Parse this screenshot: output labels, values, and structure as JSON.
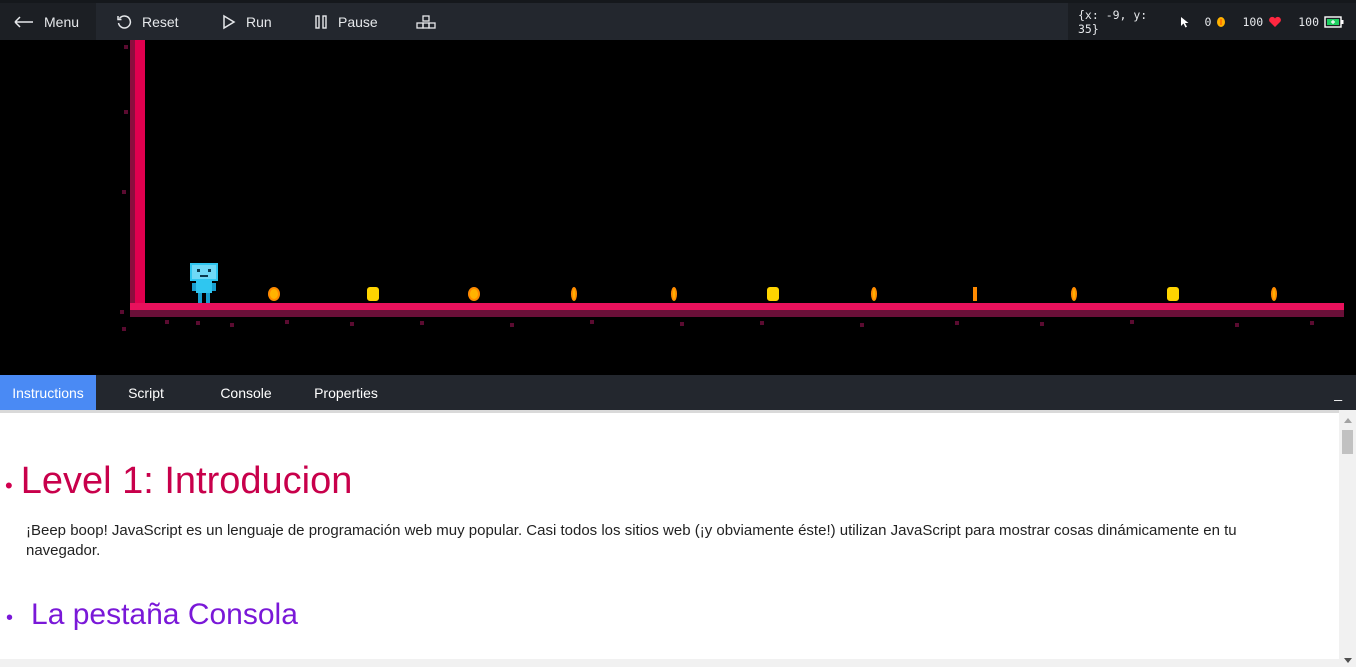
{
  "toolbar": {
    "menu_label": "Menu",
    "reset_label": "Reset",
    "run_label": "Run",
    "pause_label": "Pause",
    "grid_icon": "blocks-icon"
  },
  "status": {
    "coords": "{x: -9, y: 35}",
    "coins": "0",
    "health": "100",
    "energy": "100"
  },
  "game": {
    "colors": {
      "wall": "#e0004f",
      "floor": "#e8115c",
      "coin": "#ffb300",
      "robot": "#2fc6f0"
    }
  },
  "tabs": [
    {
      "label": "Instructions",
      "active": true
    },
    {
      "label": "Script",
      "active": false
    },
    {
      "label": "Console",
      "active": false
    },
    {
      "label": "Properties",
      "active": false
    }
  ],
  "panel": {
    "minimize_label": "_",
    "heading": "Level 1: Introducion",
    "paragraph": "¡Beep boop! JavaScript es un lenguaje de programación web muy popular. Casi todos los sitios web (¡y obviamente éste!) utilizan JavaScript para mostrar cosas dinámicamente en tu navegador.",
    "subheading": "La pestaña Consola",
    "bullet": "•"
  }
}
